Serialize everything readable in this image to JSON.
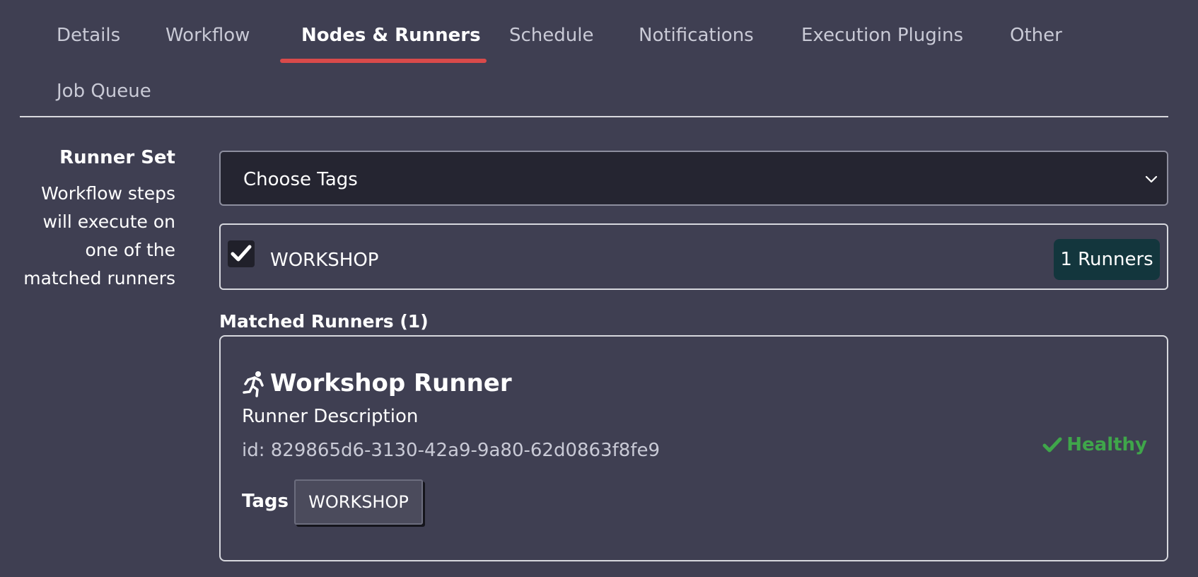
{
  "tabs": [
    {
      "label": "Details"
    },
    {
      "label": "Workflow"
    },
    {
      "label": "Nodes & Runners",
      "active": true
    },
    {
      "label": "Schedule"
    },
    {
      "label": "Notifications"
    },
    {
      "label": "Execution Plugins"
    },
    {
      "label": "Other"
    },
    {
      "label": "Job Queue"
    }
  ],
  "runner_set": {
    "title": "Runner Set",
    "description": "Workflow steps will execute on one of the matched runners"
  },
  "select": {
    "value": "Choose Tags",
    "icon": "chevron-down-icon"
  },
  "selected_tag": {
    "name": "WORKSHOP",
    "checked": true,
    "count_label": "1 Runners"
  },
  "matched": {
    "title": "Matched Runners (1)",
    "runner": {
      "icon": "running-person-icon",
      "name": "Workshop Runner",
      "description": "Runner Description",
      "id_text": "id: 829865d6-3130-42a9-9a80-62d0863f8fe9",
      "tags_label": "Tags",
      "tags": [
        "WORKSHOP"
      ],
      "status": "Healthy",
      "status_color": "#3fa64a"
    }
  },
  "colors": {
    "background": "#3f3f52",
    "accent_underline": "#d94a4a",
    "badge_bg": "#13363d"
  }
}
